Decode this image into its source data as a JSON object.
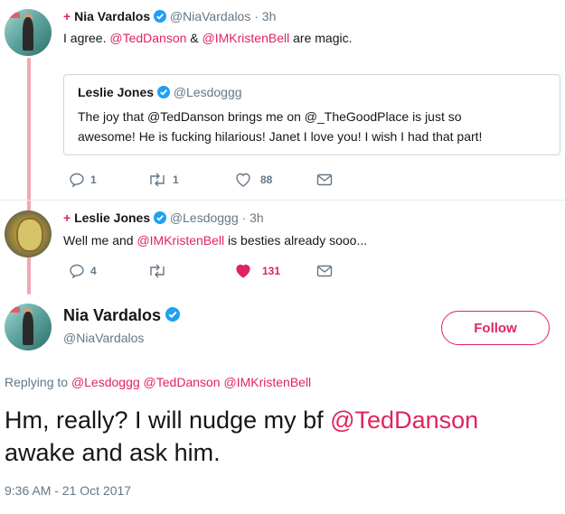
{
  "tweet1": {
    "plus": "+",
    "name": "Nia Vardalos",
    "handle": "@NiaVardalos",
    "time": "· 3h",
    "text_before": "I agree. ",
    "mention1": "@TedDanson",
    "text_mid": " & ",
    "mention2": "@IMKristenBell",
    "text_after": " are magic.",
    "quote": {
      "name": "Leslie Jones",
      "handle": "@Lesdoggg",
      "line1": "The joy that @TedDanson brings me on @_TheGoodPlace is just so",
      "line2": "awesome! He is fucking hilarious! Janet I love you! I wish I had that part!"
    },
    "actions": {
      "replies": "1",
      "retweets": "1",
      "likes": "88"
    }
  },
  "tweet2": {
    "plus": "+",
    "name": "Leslie Jones",
    "handle": "@Lesdoggg",
    "time": "· 3h",
    "text_before": "Well me and ",
    "mention": "@IMKristenBell",
    "text_after": " is besties already sooo...",
    "actions": {
      "replies": "4",
      "retweets": "",
      "likes": "131"
    }
  },
  "main": {
    "name": "Nia Vardalos",
    "handle": "@NiaVardalos",
    "follow_label": "Follow",
    "replying_prefix": "Replying to ",
    "replying_to": [
      "@Lesdoggg",
      "@TedDanson",
      "@IMKristenBell"
    ],
    "text_line1_before": "Hm, really? I will nudge my bf ",
    "text_line1_mention": "@TedDanson",
    "text_line2": "awake and ask him.",
    "timestamp": "9:36 AM - 21 Oct 2017"
  },
  "colors": {
    "accent": "#e0245e",
    "verified": "#1da1f2",
    "secondary": "#657786",
    "thread_line": "#f0a8b2"
  },
  "icons": [
    "reply-icon",
    "retweet-icon",
    "like-icon",
    "dm-icon",
    "verified-icon"
  ]
}
